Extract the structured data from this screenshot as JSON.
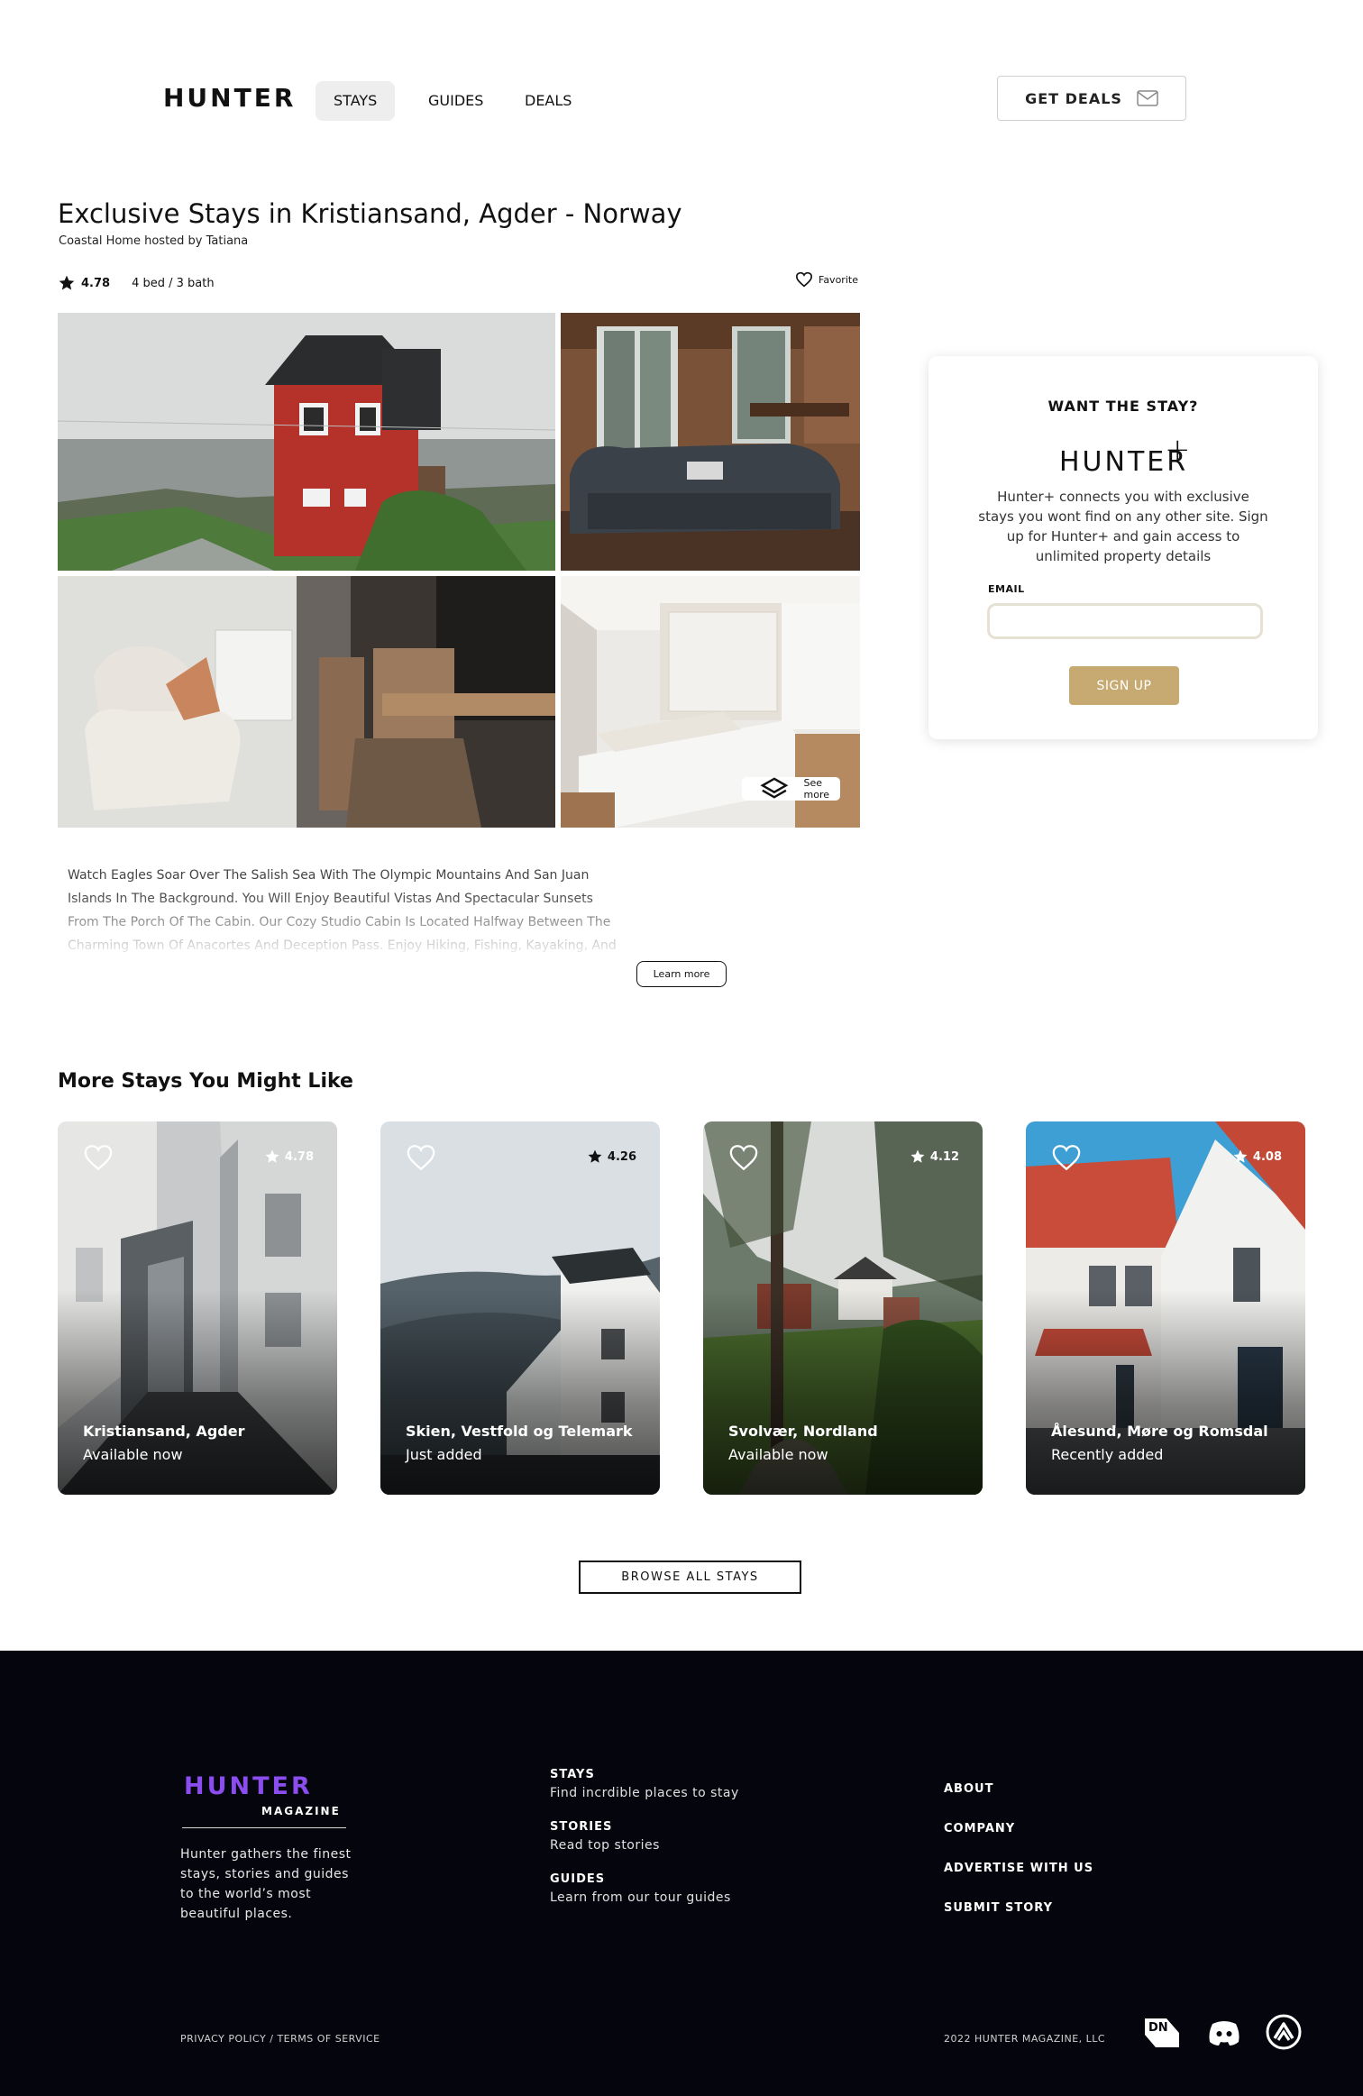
{
  "header": {
    "logo": "HUNTER",
    "nav": [
      "STAYS",
      "GUIDES",
      "DEALS"
    ],
    "get_deals": "GET DEALS"
  },
  "listing": {
    "title": "Exclusive Stays in Kristiansand, Agder - Norway",
    "host": "Coastal Home hosted by Tatiana",
    "rating": "4.78",
    "beds": "4 bed / 3 bath",
    "favorite": "Favorite",
    "see_more": "See more",
    "description": "Watch Eagles Soar Over The Salish Sea With The Olympic Mountains And San Juan Islands In The Background. You Will Enjoy Beautiful Vistas And Spectacular Sunsets From The Porch Of The Cabin. Our Cozy Studio Cabin Is Located Halfway Between The Charming Town Of Anacortes And Deception Pass. Enjoy Hiking, Fishing, Kayaking, And",
    "learn_more": "Learn more"
  },
  "signup": {
    "heading": "WANT THE STAY?",
    "brand": "HUNTER",
    "brand_plus": "+",
    "text": "Hunter+ connects you with exclusive stays you wont find on any other site. Sign up for Hunter+ and gain access to unlimited property details",
    "email_label": "EMAIL",
    "email_value": "",
    "button": "SIGN UP"
  },
  "more": {
    "title": "More Stays You Might Like",
    "cards": [
      {
        "place": "Kristiansand, Agder",
        "status": "Available now",
        "rating": "4.78"
      },
      {
        "place": "Skien,  Vestfold og Telemark",
        "status": "Just added",
        "rating": "4.26"
      },
      {
        "place": "Svolvær, Nordland",
        "status": "Available now",
        "rating": "4.12"
      },
      {
        "place": "Ålesund, Møre og Romsdal",
        "status": "Recently added",
        "rating": "4.08"
      }
    ],
    "browse": "BROWSE ALL STAYS"
  },
  "footer": {
    "logo": "HUNTER",
    "magazine": "MAGAZINE",
    "about": "Hunter gathers the finest stays, stories and guides to the world’s most beautiful places.",
    "columns": [
      {
        "head": "STAYS",
        "sub": "Find incrdible places to stay"
      },
      {
        "head": "STORIES",
        "sub": "Read top stories"
      },
      {
        "head": "GUIDES",
        "sub": "Learn from our tour guides"
      }
    ],
    "links": [
      "ABOUT",
      "COMPANY",
      "ADVERTISE WITH US",
      "SUBMIT STORY"
    ],
    "legal": "PRIVACY POLICY / TERMS OF SERVICE",
    "copyright": "2022 HUNTER MAGAZINE, LLC",
    "social_icons": [
      "dev-icon",
      "discord-icon",
      "codepen-icon"
    ]
  },
  "colors": {
    "accent_gold": "#c7aa72",
    "footer_bg": "#05060d",
    "footer_logo": "#8b4cf0"
  }
}
